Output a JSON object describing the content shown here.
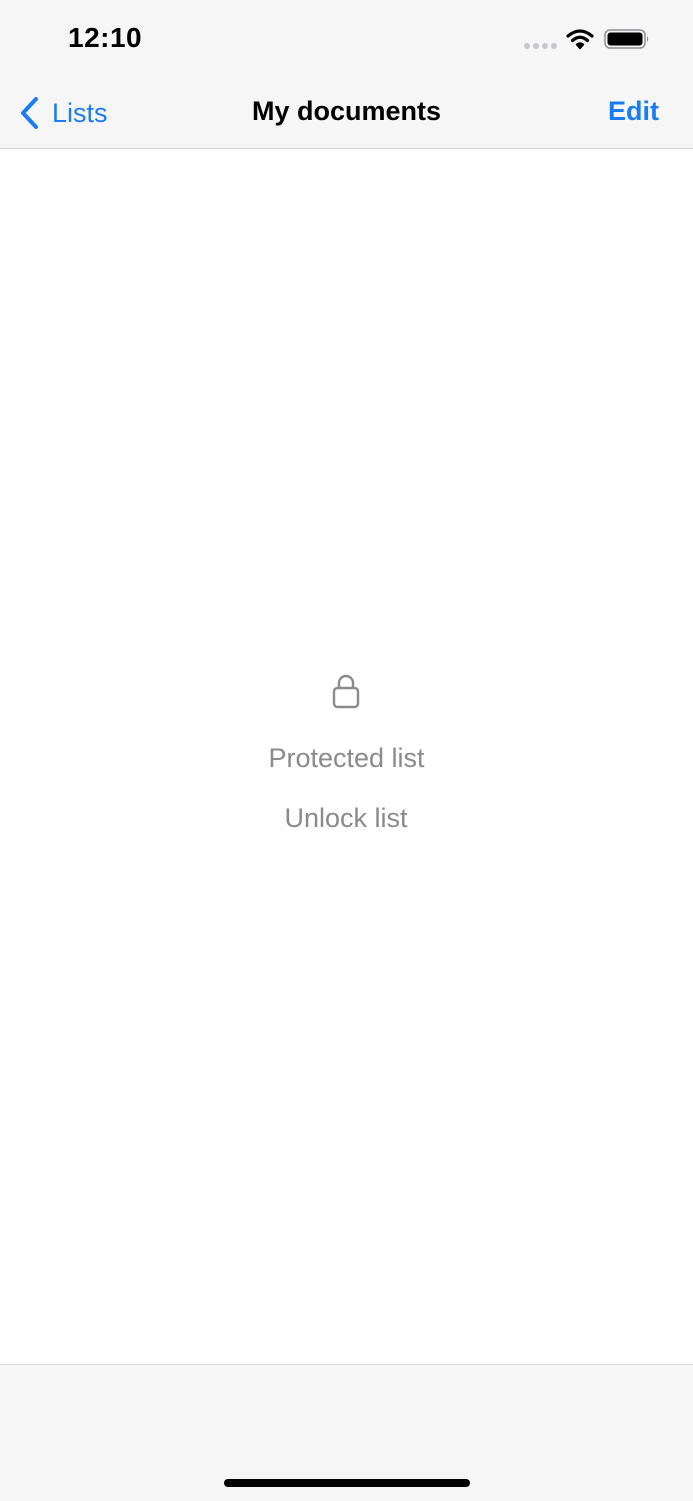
{
  "status_bar": {
    "time": "12:10"
  },
  "nav": {
    "back_label": "Lists",
    "title": "My documents",
    "edit_label": "Edit"
  },
  "locked_view": {
    "icon": "lock-icon",
    "message": "Protected list",
    "unlock_label": "Unlock list"
  },
  "colors": {
    "accent": "#1a7cf2",
    "secondary_text": "#8a8a8e",
    "bar_background": "#f6f6f6"
  }
}
